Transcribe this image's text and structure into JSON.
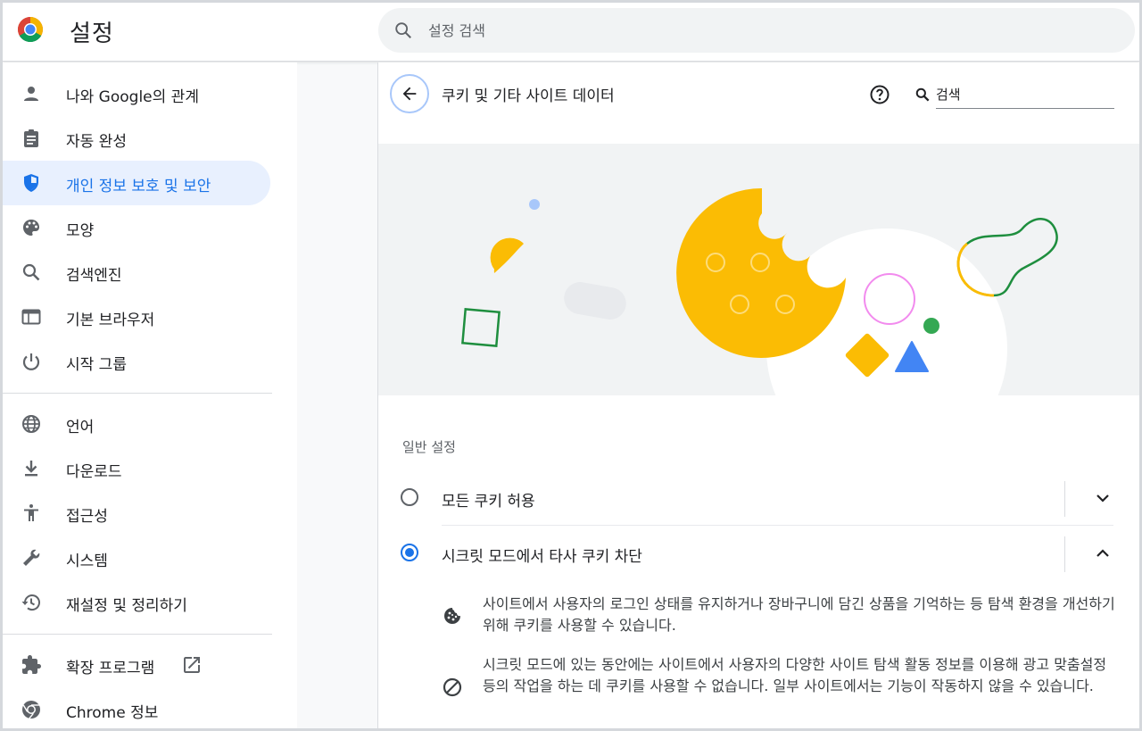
{
  "header": {
    "title": "설정",
    "search_placeholder": "설정 검색"
  },
  "sidebar": {
    "items": [
      {
        "label": "나와 Google의 관계",
        "icon": "person-icon"
      },
      {
        "label": "자동 완성",
        "icon": "clipboard-icon"
      },
      {
        "label": "개인 정보 보호 및 보안",
        "icon": "shield-icon",
        "active": true
      },
      {
        "label": "모양",
        "icon": "palette-icon"
      },
      {
        "label": "검색엔진",
        "icon": "search-icon"
      },
      {
        "label": "기본 브라우저",
        "icon": "browser-window-icon"
      },
      {
        "label": "시작 그룹",
        "icon": "power-icon"
      },
      {
        "label": "언어",
        "icon": "globe-icon"
      },
      {
        "label": "다운로드",
        "icon": "download-icon"
      },
      {
        "label": "접근성",
        "icon": "accessibility-icon"
      },
      {
        "label": "시스템",
        "icon": "wrench-icon"
      },
      {
        "label": "재설정 및 정리하기",
        "icon": "history-icon"
      },
      {
        "label": "확장 프로그램",
        "icon": "puzzle-icon"
      },
      {
        "label": "Chrome 정보",
        "icon": "chrome-icon"
      }
    ]
  },
  "main": {
    "title": "쿠키 및 기타 사이트 데이터",
    "search_placeholder": "검색",
    "section_label": "일반 설정",
    "options": [
      {
        "label": "모든 쿠키 허용",
        "selected": false,
        "expanded": false
      },
      {
        "label": "시크릿 모드에서 타사 쿠키 차단",
        "selected": true,
        "expanded": true
      }
    ],
    "details": [
      {
        "icon": "cookie-icon",
        "text": "사이트에서 사용자의 로그인 상태를 유지하거나 장바구니에 담긴 상품을 기억하는 등 탐색 환경을 개선하기 위해 쿠키를 사용할 수 있습니다."
      },
      {
        "icon": "block-icon",
        "text": "시크릿 모드에 있는 동안에는 사이트에서 사용자의 다양한 사이트 탐색 활동 정보를 이용해 광고 맞춤설정 등의 작업을 하는 데 쿠키를 사용할 수 없습니다. 일부 사이트에서는 기능이 작동하지 않을 수 있습니다."
      }
    ]
  },
  "colors": {
    "accent": "#1a73e8",
    "active_bg": "#e8f0fe",
    "cookie": "#fbbc04",
    "green": "#34a853",
    "blue": "#4285f4",
    "pink": "#f28bee"
  }
}
